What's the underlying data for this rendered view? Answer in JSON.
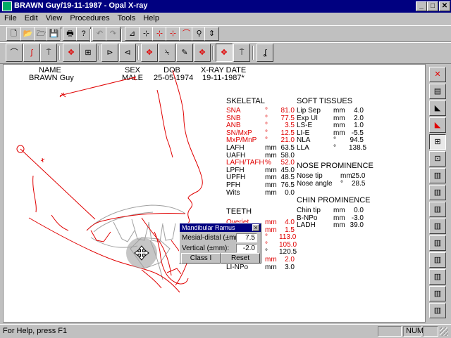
{
  "window": {
    "title": "BRAWN Guy/19-11-1987 - Opal X-ray",
    "controls": [
      "_",
      "□",
      "✕"
    ]
  },
  "menu": [
    "File",
    "Edit",
    "View",
    "Procedures",
    "Tools",
    "Help"
  ],
  "toolbar1": [
    {
      "name": "new-icon",
      "glyph": "🗋"
    },
    {
      "name": "open-icon",
      "glyph": "📂"
    },
    {
      "name": "open-folder-icon",
      "glyph": "🗁"
    },
    {
      "name": "save-icon",
      "glyph": "💾"
    },
    {
      "name": "print-icon",
      "glyph": "🖶"
    },
    {
      "name": "help-pointer-icon",
      "glyph": "?"
    },
    {
      "name": "undo-icon",
      "glyph": "↶"
    },
    {
      "name": "redo-icon",
      "glyph": "↷"
    },
    {
      "name": "trace-icon",
      "glyph": "⊿"
    },
    {
      "name": "point-icon",
      "glyph": "⊹"
    },
    {
      "name": "point-red-icon",
      "glyph": "⊹"
    },
    {
      "name": "point-move-icon",
      "glyph": "⊹"
    },
    {
      "name": "curve-icon",
      "glyph": "⌒"
    },
    {
      "name": "tooth-icon",
      "glyph": "⚲"
    },
    {
      "name": "measure-icon",
      "glyph": "⇕"
    }
  ],
  "toolbar2": [
    {
      "name": "maxilla-icon",
      "glyph": "⌒"
    },
    {
      "name": "profile-icon",
      "glyph": "ʃ"
    },
    {
      "name": "teeth-icon",
      "glyph": "⍑"
    },
    {
      "name": "upper-teeth-move-icon",
      "glyph": "✥"
    },
    {
      "name": "teeth-grid-icon",
      "glyph": "⊞"
    },
    {
      "name": "mandible-triangle-icon",
      "glyph": "⊳"
    },
    {
      "name": "rotate-triangle-icon",
      "glyph": "⊲"
    },
    {
      "name": "incisor-move-icon",
      "glyph": "✥"
    },
    {
      "name": "incisor-tilt-icon",
      "glyph": "⍀"
    },
    {
      "name": "incisor-draw-icon",
      "glyph": "✎"
    },
    {
      "name": "molar-move-icon",
      "glyph": "✥"
    },
    {
      "name": "mandible-move-icon",
      "glyph": "✥"
    },
    {
      "name": "mandible-teeth-icon",
      "glyph": "⍑"
    },
    {
      "name": "chin-icon",
      "glyph": "ʆ"
    }
  ],
  "header": {
    "labels": {
      "name": "NAME",
      "sex": "SEX",
      "dob": "DOB",
      "xray_date": "X-RAY DATE"
    },
    "values": {
      "name": "BRAWN Guy",
      "sex": "MALE",
      "dob": "25-05-1974",
      "xray_date": "19-11-1987*"
    }
  },
  "skeletal": {
    "title": "SKELETAL",
    "rows": [
      {
        "label": "SNA",
        "unit": "°",
        "value": "81.0",
        "red": true
      },
      {
        "label": "SNB",
        "unit": "°",
        "value": "77.5",
        "red": true
      },
      {
        "label": "ANB",
        "unit": "°",
        "value": "3.5",
        "red": true
      },
      {
        "label": "SN/MxP",
        "unit": "°",
        "value": "12.5",
        "red": true
      },
      {
        "label": "MxP/MnP",
        "unit": "°",
        "value": "21.0",
        "red": true
      },
      {
        "label": "LAFH",
        "unit": "mm",
        "value": "63.5",
        "red": false
      },
      {
        "label": "UAFH",
        "unit": "mm",
        "value": "58.0",
        "red": false
      },
      {
        "label": "LAFH/TAFH",
        "unit": "%",
        "value": "52.0",
        "red": true
      },
      {
        "label": "LPFH",
        "unit": "mm",
        "value": "45.0",
        "red": false
      },
      {
        "label": "UPFH",
        "unit": "mm",
        "value": "48.5",
        "red": false
      },
      {
        "label": "PFH",
        "unit": "mm",
        "value": "76.5",
        "red": false
      },
      {
        "label": "Wits",
        "unit": "mm",
        "value": "0.0",
        "red": false
      }
    ]
  },
  "teeth": {
    "title": "TEETH",
    "rows": [
      {
        "label": "Overjet",
        "unit": "mm",
        "value": "4.0",
        "red": true
      },
      {
        "label": "",
        "unit": "mm",
        "value": "1.5",
        "red": true
      },
      {
        "label": "",
        "unit": "°",
        "value": "113.0",
        "red": true
      },
      {
        "label": "",
        "unit": "°",
        "value": "105.0",
        "red": true
      },
      {
        "label": "",
        "unit": "°",
        "value": "120.5",
        "red": false
      },
      {
        "label": "",
        "unit": "mm",
        "value": "2.0",
        "red": true
      },
      {
        "label": "LI-NPo",
        "unit": "mm",
        "value": "3.0",
        "red": false
      }
    ]
  },
  "soft_tissues": {
    "title": "SOFT TISSUES",
    "rows": [
      {
        "label": "Lip Sep",
        "unit": "mm",
        "value": "4.0"
      },
      {
        "label": "Exp UI",
        "unit": "mm",
        "value": "2.0"
      },
      {
        "label": "LS-E",
        "unit": "mm",
        "value": "1.0"
      },
      {
        "label": "LI-E",
        "unit": "mm",
        "value": "-5.5"
      },
      {
        "label": "NLA",
        "unit": "°",
        "value": "94.5"
      },
      {
        "label": "LLA",
        "unit": "°",
        "value": "138.5"
      }
    ]
  },
  "nose": {
    "title": "NOSE PROMINENCE",
    "rows": [
      {
        "label": "Nose tip",
        "unit": "mm",
        "value": "25.0"
      },
      {
        "label": "Nose angle",
        "unit": "°",
        "value": "28.5"
      }
    ]
  },
  "chin": {
    "title": "CHIN PROMINENCE",
    "rows": [
      {
        "label": "Chin tip",
        "unit": "mm",
        "value": "0.0"
      },
      {
        "label": "B-NPo",
        "unit": "mm",
        "value": "-3.0"
      },
      {
        "label": "LADH",
        "unit": "mm",
        "value": "39.0"
      }
    ]
  },
  "dialog": {
    "title": "Mandibular Ramus",
    "mesial_label": "Mesial-distal (±mm):",
    "mesial_value": "7.5",
    "vertical_label": "Vertical (±mm):",
    "vertical_value": "-2.0",
    "class_button": "Class I",
    "reset_button": "Reset"
  },
  "side_tools": [
    "ruler-cross-icon",
    "document-icon",
    "triangle-measure-icon",
    "triangle-red-icon",
    "grid-overlay-icon",
    "teeth-chart-icon",
    "bars-chart-icon",
    "bars-chart-2-icon",
    "bars-chart-3-icon",
    "bars-chart-4-icon",
    "bars-chart-5-icon",
    "bars-chart-6-icon",
    "bars-chart-7-icon",
    "bars-chart-8-icon",
    "bars-chart-9-icon"
  ],
  "status": {
    "help": "For Help, press F1",
    "num": "NUM"
  },
  "colors": {
    "title_bar": "#000080",
    "trace_red": "#e00000",
    "template_gray": "#a0a0a0"
  }
}
